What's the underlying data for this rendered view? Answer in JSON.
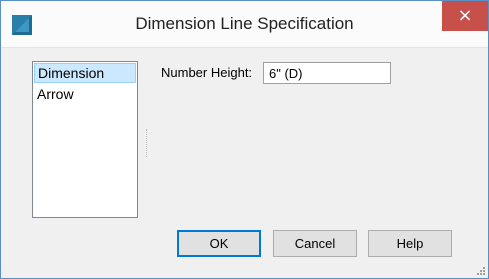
{
  "window": {
    "title": "Dimension Line Specification",
    "close_glyph": "×",
    "app_icon": "app-icon",
    "accent_color": "#5a8fc6",
    "close_color": "#c7504b"
  },
  "sidebar": {
    "items": [
      {
        "label": "Dimension",
        "selected": true
      },
      {
        "label": "Arrow",
        "selected": false
      }
    ]
  },
  "form": {
    "number_height_label": "Number Height:",
    "number_height_value": "6\" (D)"
  },
  "buttons": {
    "ok_label": "OK",
    "cancel_label": "Cancel",
    "help_label": "Help"
  }
}
